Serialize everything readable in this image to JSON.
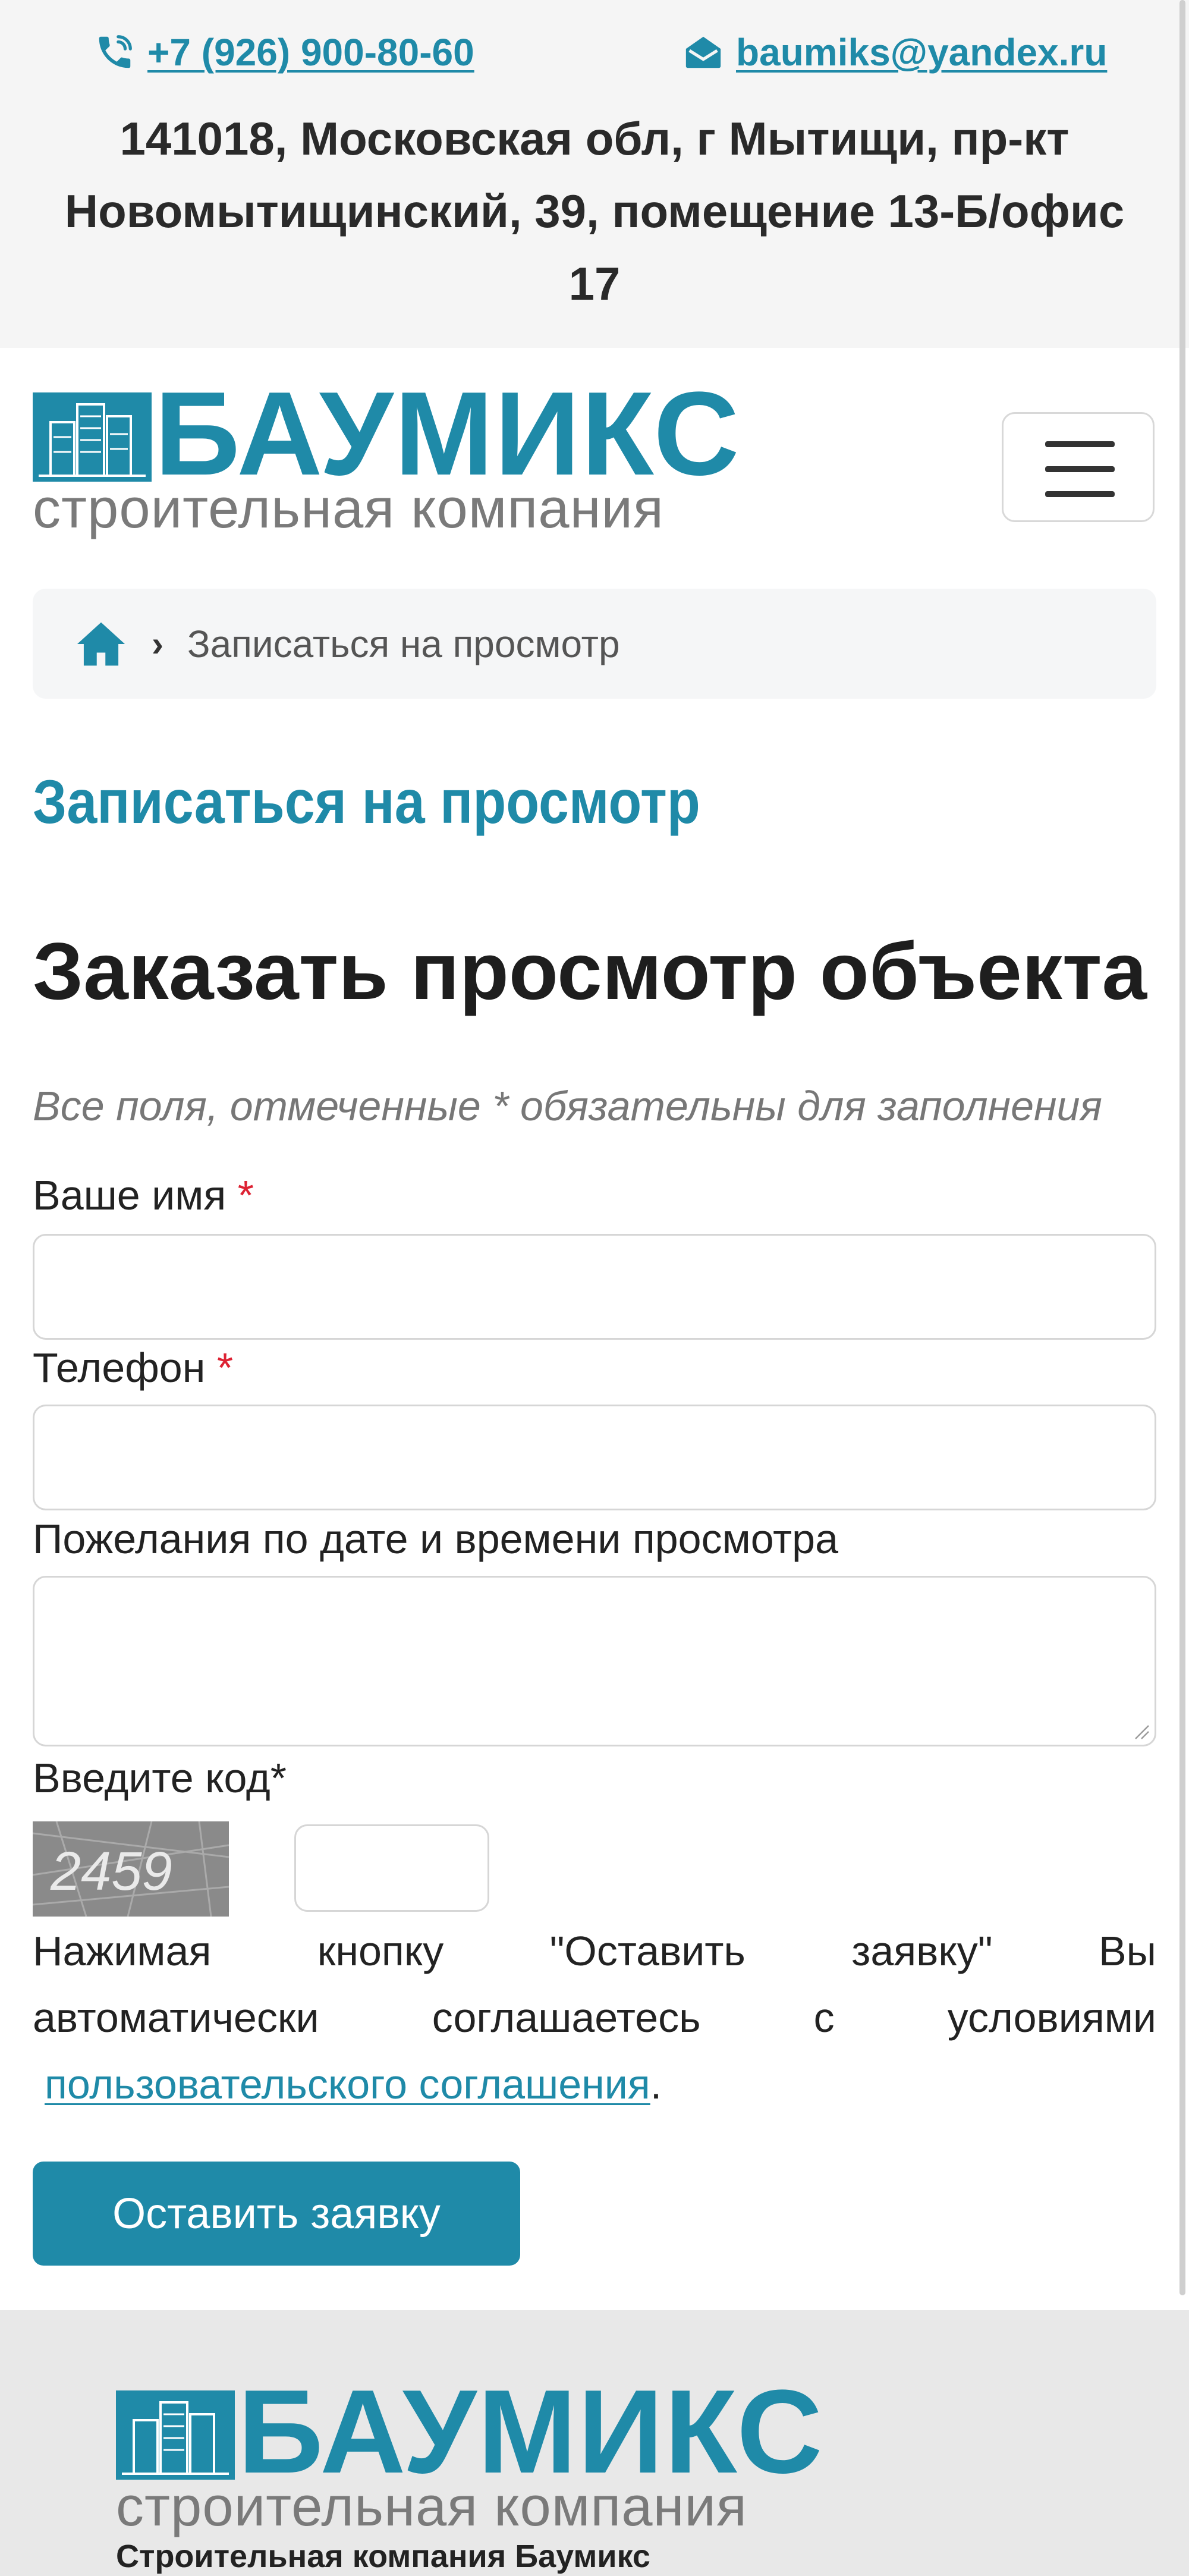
{
  "topbar": {
    "phone": "+7 (926) 900-80-60",
    "email": "baumiks@yandex.ru",
    "address_lines": [
      "141018, Московская обл, г Мытищи, пр-кт",
      "Новомытищинский, 39, помещение 13-Б/офис",
      "17"
    ]
  },
  "brand": {
    "name": "БАУМИКС",
    "tagline": "строительная компания",
    "color": "#1f8aa8"
  },
  "breadcrumb": {
    "home_icon": "home-icon",
    "current": "Записаться на просмотр"
  },
  "page": {
    "heading": "Записаться на просмотр",
    "form_title": "Заказать просмотр объекта",
    "required_note": "Все поля, отмеченные * обязательны для заполнения"
  },
  "form": {
    "name_label": "Ваше имя",
    "phone_label": "Телефон",
    "wishes_label": "Пожелания по дате и времени просмотра",
    "captcha_label": "Введите код*",
    "captcha_code": "2459",
    "required_mark": "*",
    "name_value": "",
    "phone_value": "",
    "wishes_value": "",
    "captcha_value": ""
  },
  "consent": {
    "words_line1": [
      "Нажимая",
      "кнопку",
      "\"Оставить",
      "заявку\"",
      "Вы"
    ],
    "words_line2": [
      "автоматически",
      "соглашаетесь",
      "с",
      "условиями"
    ],
    "link": "пользовательского соглашения",
    "end": "."
  },
  "submit_label": "Оставить заявку",
  "footer": {
    "company": "Строительная компания Баумикс"
  }
}
